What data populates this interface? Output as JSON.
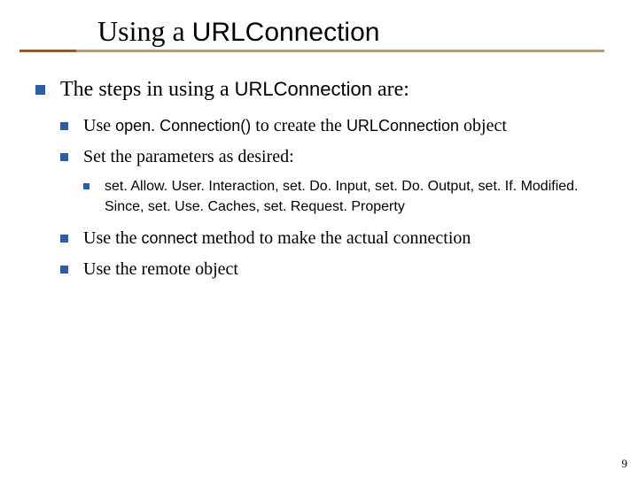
{
  "title": {
    "prefix": "Using a ",
    "code": "URLConnection"
  },
  "main": {
    "intro": {
      "pre": "The steps in using a ",
      "code": "URLConnection",
      "post": " are:"
    },
    "steps": [
      {
        "pre": "Use ",
        "code": "open. Connection()",
        "mid": " to create the ",
        "code2": "URLConnection",
        "post": " object"
      },
      {
        "text": "Set the parameters as desired:",
        "sub": [
          "set. Allow. User. Interaction",
          "set. Do. Input",
          "set. Do. Output",
          "set. If. Modified. Since",
          "set. Use. Caches",
          "set. Request. Property"
        ]
      },
      {
        "pre": "Use the ",
        "code": "connect",
        "post": " method to make the actual connection"
      },
      {
        "text": "Use the remote object"
      }
    ]
  },
  "pageNumber": "9"
}
